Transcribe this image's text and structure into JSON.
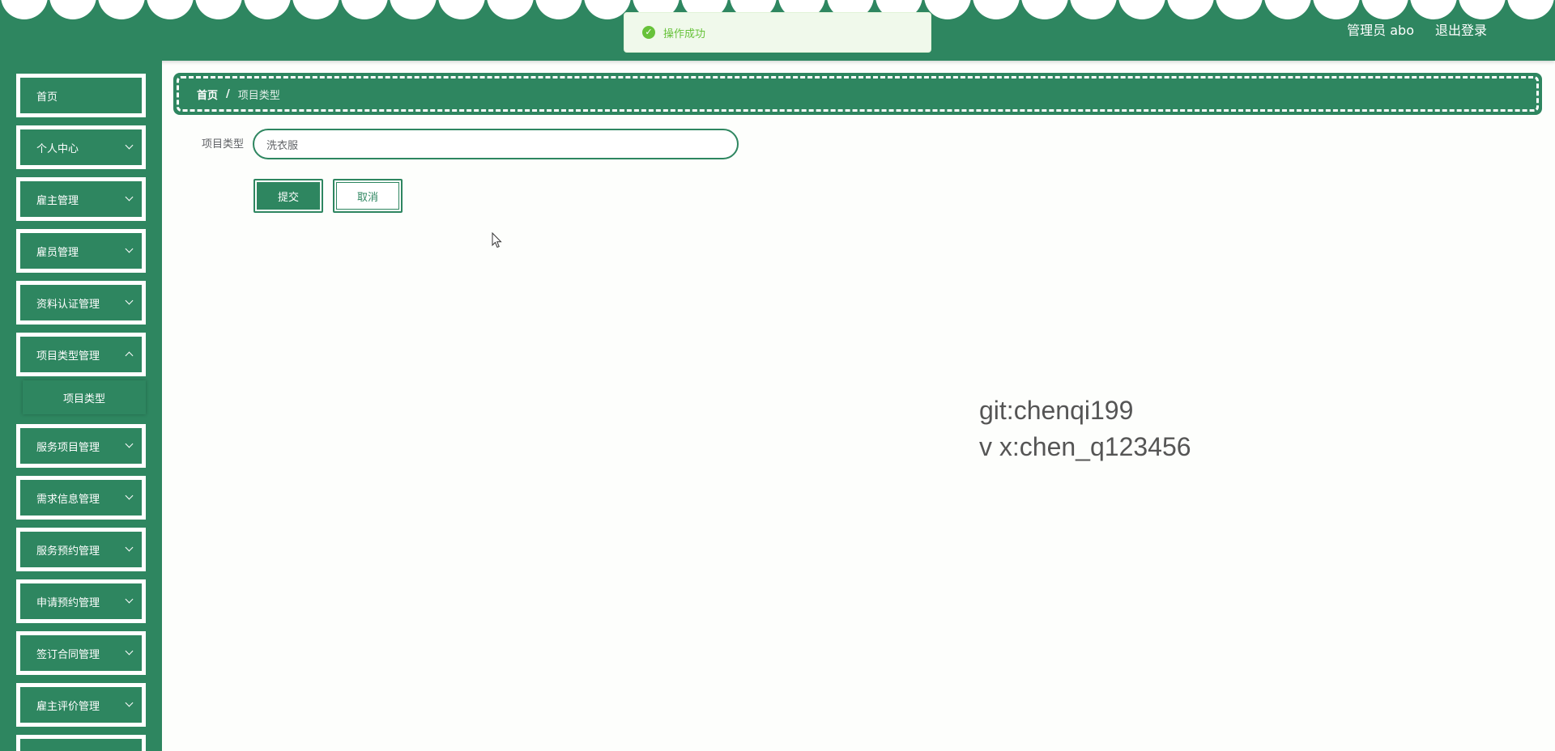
{
  "header": {
    "user_label": "管理员 abo",
    "logout_label": "退出登录",
    "bg_color": "#2e8660"
  },
  "toast": {
    "message": "操作成功",
    "icon": "check-circle-icon",
    "color": "#67c23a"
  },
  "sidebar": {
    "items": [
      {
        "label": "首页",
        "has_arrow": false
      },
      {
        "label": "个人中心",
        "has_arrow": true
      },
      {
        "label": "雇主管理",
        "has_arrow": true
      },
      {
        "label": "雇员管理",
        "has_arrow": true
      },
      {
        "label": "资料认证管理",
        "has_arrow": true
      },
      {
        "label": "项目类型管理",
        "has_arrow": true,
        "expanded": true
      },
      {
        "label": "服务项目管理",
        "has_arrow": true
      },
      {
        "label": "需求信息管理",
        "has_arrow": true
      },
      {
        "label": "服务预约管理",
        "has_arrow": true
      },
      {
        "label": "申请预约管理",
        "has_arrow": true
      },
      {
        "label": "签订合同管理",
        "has_arrow": true
      },
      {
        "label": "雇主评价管理",
        "has_arrow": true
      }
    ],
    "submenu": {
      "label": "项目类型"
    }
  },
  "breadcrumb": {
    "home": "首页",
    "separator": "/",
    "current": "项目类型"
  },
  "form": {
    "field_label": "项目类型",
    "field_value": "洗衣服",
    "submit_label": "提交",
    "cancel_label": "取消"
  },
  "watermark": {
    "line1": "git:chenqi199",
    "line2": "v x:chen_q123456"
  }
}
